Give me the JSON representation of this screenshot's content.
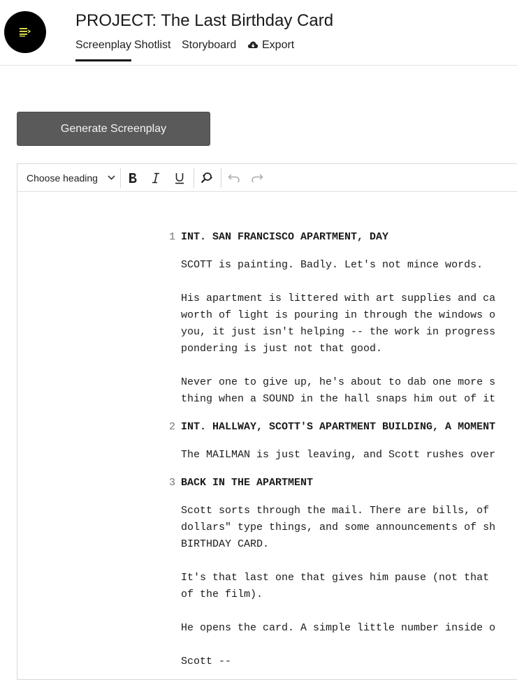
{
  "header": {
    "title": "PROJECT: The Last Birthday Card",
    "tabs": [
      {
        "label": "Screenplay",
        "active": true
      },
      {
        "label": "Shotlist",
        "active": false
      },
      {
        "label": "Storyboard",
        "active": false
      },
      {
        "label": "Export",
        "active": false,
        "icon": "cloud-download-icon"
      }
    ]
  },
  "actions": {
    "generate_label": "Generate Screenplay"
  },
  "toolbar": {
    "heading_select": "Choose heading",
    "buttons": [
      "bold-icon",
      "italic-icon",
      "underline-icon",
      "find-replace-icon",
      "undo-icon",
      "redo-icon"
    ]
  },
  "screenplay": {
    "scene_numbers": [
      "1",
      "2",
      "3"
    ],
    "lines": [
      "INT. SAN FRANCISCO APARTMENT, DAY",
      "SCOTT is painting. Badly. Let's not mince words.",
      "His apartment is littered with art supplies and ca",
      "worth of light is pouring in through the windows o",
      "you, it just isn't helping -- the work in progress",
      "pondering is just not that good.",
      "Never one to give up, he's about to dab one more s",
      "thing when a SOUND in the hall snaps him out of it",
      "INT. HALLWAY, SCOTT'S APARTMENT BUILDING, A MOMENT",
      "The MAILMAN is just leaving, and Scott rushes over",
      "BACK IN THE APARTMENT",
      "Scott sorts through the mail. There are bills, of",
      "dollars\" type things, and some announcements of sh",
      "BIRTHDAY CARD.",
      "It's that last one that gives him pause (not that",
      "of the film).",
      "He opens the card. A simple little number inside o",
      "Scott --"
    ]
  },
  "colors": {
    "logo_bg": "#000000",
    "logo_icon": "#d8d84a",
    "button_bg": "#5a5a5a"
  }
}
